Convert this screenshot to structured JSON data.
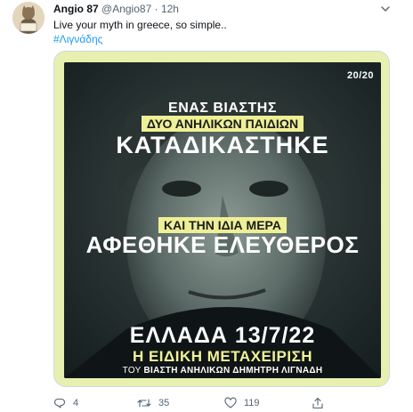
{
  "tweet": {
    "author_name": "Angio 87",
    "handle": "@Angio87",
    "separator": "·",
    "time": "12h",
    "text": "Live your myth in greece, so simple..",
    "hashtag": "#Λιγνάδης"
  },
  "poster": {
    "brand": "20/20",
    "line1": "ΕΝΑΣ ΒΙΑΣΤΗΣ",
    "line2": "ΔΥΟ ΑΝΗΛΙΚΩΝ ΠΑΙΔΙΩΝ",
    "line3": "ΚΑΤΑΔΙΚΑΣΤΗΚΕ",
    "line4": "ΚΑΙ ΤΗΝ ΙΔΙΑ ΜΕΡΑ",
    "line5": "ΑΦΕΘΗΚΕ ΕΛΕΥΘΕΡΟΣ",
    "line6": "ΕΛΛΑΔΑ 13/7/22",
    "line7": "Η ΕΙΔΙΚΗ ΜΕΤΑΧΕΙΡΙΣΗ",
    "line8_prefix": "ΤΟΥ",
    "line8_rest": "ΒΙΑΣΤΗ ΑΝΗΛΙΚΩΝ ΔΗΜΗΤΡΗ ΛΙΓΝΑΔΗ",
    "background_color": "#1c2a2b",
    "highlight_color": "#eef096"
  },
  "actions": {
    "reply_count": "4",
    "retweet_count": "35",
    "like_count": "119",
    "icons": [
      "reply-icon",
      "retweet-icon",
      "like-icon",
      "share-icon"
    ]
  },
  "colors": {
    "accent": "#1d9bf0",
    "muted": "#536471",
    "media_frame": "#e8f0b0"
  }
}
